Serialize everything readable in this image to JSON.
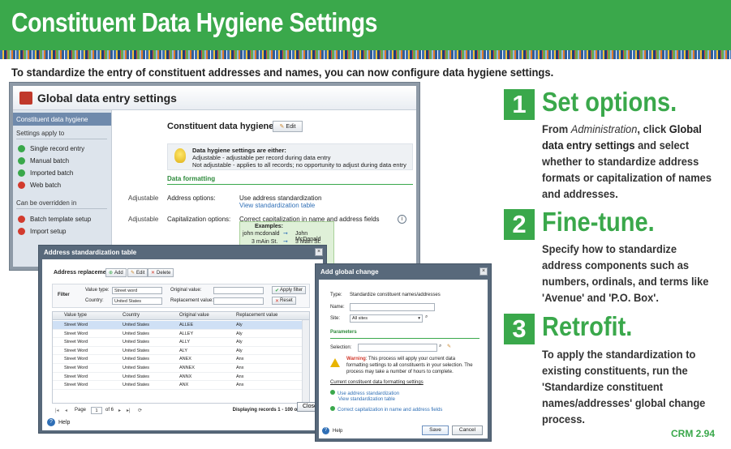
{
  "banner": {
    "title": "Constituent Data Hygiene Settings"
  },
  "intro": "To standardize the entry of constituent addresses and names, you can now configure data hygiene settings.",
  "global_window": {
    "title": "Global data entry settings",
    "sidebar": {
      "header": "Constituent data hygiene",
      "apply_label": "Settings apply to",
      "apply_items": [
        {
          "label": "Single record entry",
          "status": "ok"
        },
        {
          "label": "Manual batch",
          "status": "ok"
        },
        {
          "label": "Imported batch",
          "status": "ok"
        },
        {
          "label": "Web batch",
          "status": "no"
        }
      ],
      "override_label": "Can be overridden in",
      "override_items": [
        {
          "label": "Batch template setup",
          "status": "no"
        },
        {
          "label": "Import setup",
          "status": "no"
        }
      ]
    },
    "main": {
      "title": "Constituent data hygiene",
      "edit": "Edit",
      "info_title": "Data hygiene settings are either:",
      "info_line1": "Adjustable - adjustable per record during data entry",
      "info_line2": "Not adjustable - applies to all records; no opportunity to adjust during data entry",
      "section": "Data formatting",
      "rows": [
        {
          "adj": "Adjustable",
          "label": "Address options:",
          "value": "Use address standardization",
          "link": "View standardization table"
        },
        {
          "adj": "Adjustable",
          "label": "Capitalization options:",
          "value": "Correct capitalization in name and address fields"
        }
      ],
      "examples_title": "Examples:",
      "examples": [
        {
          "from": "john mcdonald",
          "to": "John McDonald"
        },
        {
          "from": "3 mAin St.",
          "to": "3 Main St."
        }
      ]
    }
  },
  "addr_window": {
    "title": "Address standardization table",
    "toolbar_label": "Address replacements",
    "buttons": {
      "add": "Add",
      "edit": "Edit",
      "delete": "Delete"
    },
    "filter": {
      "label": "Filter",
      "value_type_label": "Value type:",
      "value_type": "Street word",
      "country_label": "Country:",
      "country": "United States",
      "original_label": "Original value:",
      "replacement_label": "Replacement value:",
      "apply": "Apply filter",
      "reset": "Reset"
    },
    "columns": [
      "Value type",
      "Country",
      "Original value",
      "Replacement value"
    ],
    "rows": [
      [
        "Street Word",
        "United States",
        "ALLEE",
        "Aly"
      ],
      [
        "Street Word",
        "United States",
        "ALLEY",
        "Aly"
      ],
      [
        "Street Word",
        "United States",
        "ALLY",
        "Aly"
      ],
      [
        "Street Word",
        "United States",
        "ALY",
        "Aly"
      ],
      [
        "Street Word",
        "United States",
        "ANEX",
        "Anx"
      ],
      [
        "Street Word",
        "United States",
        "ANNEX",
        "Anx"
      ],
      [
        "Street Word",
        "United States",
        "ANNX",
        "Anx"
      ],
      [
        "Street Word",
        "United States",
        "ANX",
        "Anx"
      ]
    ],
    "pager": {
      "page_label": "Page",
      "page": "1",
      "of": "of 6",
      "status": "Displaying records 1 - 100 of 587"
    },
    "help": "Help",
    "close": "Close"
  },
  "change_window": {
    "title": "Add global change",
    "type_label": "Type:",
    "type_value": "Standardize constituent names/addresses",
    "name_label": "Name:",
    "site_label": "Site:",
    "site_value": "All sites",
    "params_label": "Parameters",
    "selection_label": "Selection:",
    "warning_bold": "Warning",
    "warning_text": ": This process will apply your current data formatting settings to all constituents in your selection. The process may take a number of hours to complete.",
    "current_label": "Current constituent data formatting settings",
    "current_items": [
      "Use address standardization",
      "Correct capitalization in name and address fields"
    ],
    "view_link": "View standardization table",
    "help": "Help",
    "save": "Save",
    "cancel": "Cancel"
  },
  "steps": [
    {
      "num": "1",
      "title": "Set options.",
      "pre": "From ",
      "italic": "Administration",
      "mid": ", click ",
      "bold": "Global data entry settings",
      "post": " and select whether to standardize address formats or capitalization of names and addresses."
    },
    {
      "num": "2",
      "title": "Fine-tune.",
      "text": "Specify how to standardize address components such as numbers, ordinals, and terms like 'Avenue' and 'P.O. Box'."
    },
    {
      "num": "3",
      "title": "Retrofit.",
      "text": "To apply the standardization to existing constituents, run the 'Standardize constituent names/addresses' global change process."
    }
  ],
  "footer": "CRM 2.94"
}
